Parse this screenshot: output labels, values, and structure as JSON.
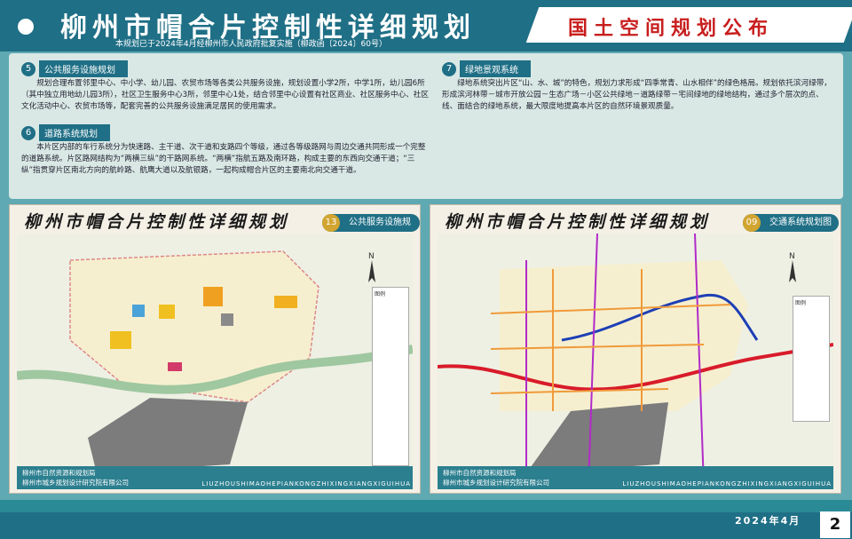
{
  "header": {
    "title": "柳州市帽合片控制性详细规划",
    "subtitle": "本规划已于2024年4月经柳州市人民政府批复实施（柳政函〔2024〕60号）",
    "notice": "国土空间规划公布"
  },
  "sections": [
    {
      "num": "5",
      "title": "公共服务设施规划",
      "text": "规划合理布置邻里中心、中小学、幼儿园、农贸市场等各类公共服务设施，规划设置小学2所，中学1所，幼儿园6所（其中独立用地幼儿园3所），社区卫生服务中心3所，邻里中心1处，结合邻里中心设置有社区商业、社区服务中心、社区文化活动中心、农贸市场等，配套完善的公共服务设施满足居民的使用需求。"
    },
    {
      "num": "6",
      "title": "道路系统规划",
      "text": "本片区内部的车行系统分为快速路、主干道、次干道和支路四个等级，通过各等级路网与周边交通共同形成一个完整的道路系统。片区路网结构为“两横三纵”的干路网系统。“两横”指航五路及南环路，构成主要的东西向交通干道；“三纵”指贯穿片区南北方向的航岭路、航鹰大道以及航银路，一起构成帽合片区的主要南北向交通干道。"
    },
    {
      "num": "7",
      "title": "绿地景观系统",
      "text": "绿地系统突出片区“山、水、城”的特色，规划力求形成“四季常青、山水相伴”的绿色格局。规划依托滨河绿带，形成滨河林带－城市开放公园－生态广场－小区公共绿地－道路绿带－宅间绿地的绿地结构，通过多个层次的点、线、面结合的绿地系统，最大限度地提高本片区的自然环境景观质量。"
    }
  ],
  "maps": [
    {
      "title": "柳州市帽合片控制性详细规划",
      "num": "13",
      "label": "公共服务设施规划图",
      "legend": "图例"
    },
    {
      "title": "柳州市帽合片控制性详细规划",
      "num": "09",
      "label": "交通系统规划图",
      "legend": "图例"
    }
  ],
  "org": {
    "line1": "柳州市自然资源和规划局",
    "line2": "柳州市城乡规划设计研究院有限公司"
  },
  "pinyin": "LIUZHOUSHIMAOHEPIANKONGZHIXINGXIANGXIGUIHUA",
  "footer": {
    "date": "2024年4月",
    "page": "2"
  }
}
